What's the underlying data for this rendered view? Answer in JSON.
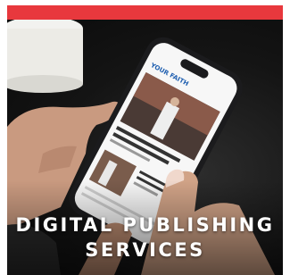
{
  "caption": {
    "line1": "DIGITAL PUBLISHING",
    "line2": "SERVICES"
  },
  "phone_screen": {
    "section_label": "YOUR FAITH"
  },
  "colors": {
    "accent": "#e8383d",
    "caption_text": "#ffffff"
  }
}
